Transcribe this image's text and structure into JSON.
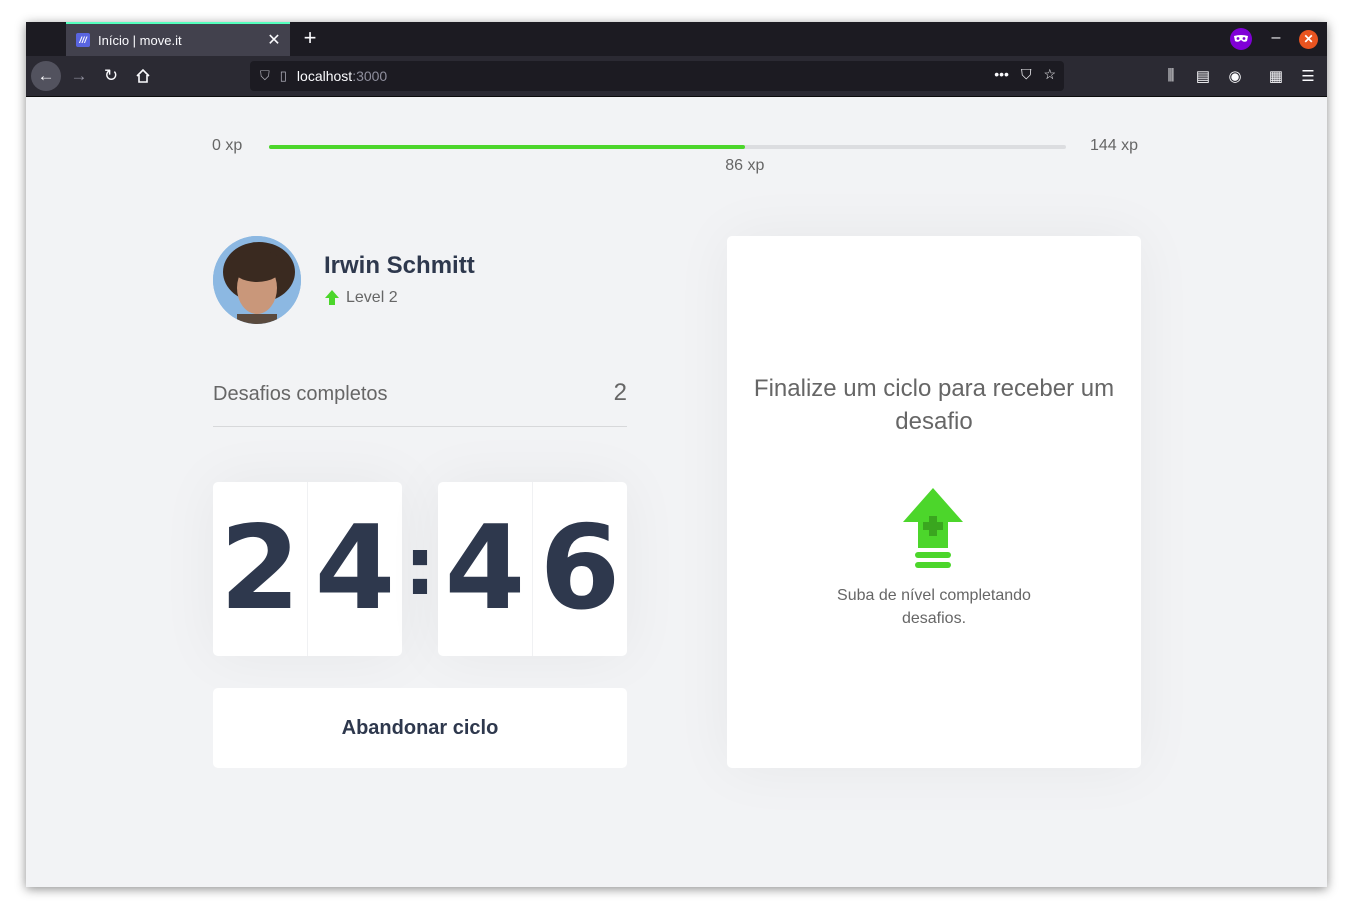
{
  "browser": {
    "tab_title": "Início | move.it",
    "tab_favicon_text": "///",
    "url_host": "localhost",
    "url_port": ":3000"
  },
  "xp": {
    "min_label": "0 xp",
    "max_label": "144 xp",
    "current_label": "86 xp",
    "progress_fraction": 0.597
  },
  "profile": {
    "name": "Irwin Schmitt",
    "level_label": "Level 2"
  },
  "completed": {
    "label": "Desafios completos",
    "count": "2"
  },
  "countdown": {
    "minute_left": "2",
    "minute_right": "4",
    "separator": ":",
    "second_left": "4",
    "second_right": "6"
  },
  "abandon_button": "Abandonar ciclo",
  "challenge": {
    "title": "Finalize um ciclo para receber um desafio",
    "hint": "Suba de nível completando desafios."
  },
  "colors": {
    "accent_green": "#4cd62b",
    "title_dark": "#2e384d",
    "text_gray": "#666666",
    "background": "#f2f3f5"
  }
}
